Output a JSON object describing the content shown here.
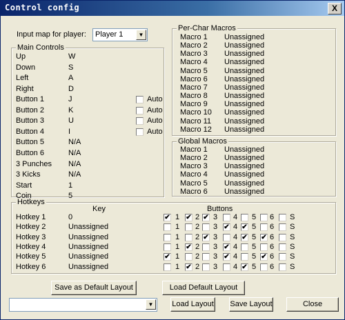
{
  "window": {
    "title": "Control config",
    "close_label": "X"
  },
  "player": {
    "label": "Input map for player:",
    "selected": "Player 1"
  },
  "main_controls": {
    "title": "Main Controls",
    "auto_label": "Auto",
    "rows": [
      {
        "name": "Up",
        "key": "W"
      },
      {
        "name": "Down",
        "key": "S"
      },
      {
        "name": "Left",
        "key": "A"
      },
      {
        "name": "Right",
        "key": "D"
      },
      {
        "name": "Button 1",
        "key": "J"
      },
      {
        "name": "Button 2",
        "key": "K"
      },
      {
        "name": "Button 3",
        "key": "U"
      },
      {
        "name": "Button 4",
        "key": "I"
      },
      {
        "name": "Button 5",
        "key": "N/A"
      },
      {
        "name": "Button 6",
        "key": "N/A"
      },
      {
        "name": "3 Punches",
        "key": "N/A"
      },
      {
        "name": "3 Kicks",
        "key": "N/A"
      },
      {
        "name": "Start",
        "key": "1"
      },
      {
        "name": "Coin",
        "key": "5"
      }
    ],
    "auto_checked": [
      false,
      false,
      false,
      false
    ]
  },
  "per_char_macros": {
    "title": "Per-Char Macros",
    "rows": [
      {
        "name": "Macro 1",
        "value": "Unassigned"
      },
      {
        "name": "Macro 2",
        "value": "Unassigned"
      },
      {
        "name": "Macro 3",
        "value": "Unassigned"
      },
      {
        "name": "Macro 4",
        "value": "Unassigned"
      },
      {
        "name": "Macro 5",
        "value": "Unassigned"
      },
      {
        "name": "Macro 6",
        "value": "Unassigned"
      },
      {
        "name": "Macro 7",
        "value": "Unassigned"
      },
      {
        "name": "Macro 8",
        "value": "Unassigned"
      },
      {
        "name": "Macro 9",
        "value": "Unassigned"
      },
      {
        "name": "Macro 10",
        "value": "Unassigned"
      },
      {
        "name": "Macro 11",
        "value": "Unassigned"
      },
      {
        "name": "Macro 12",
        "value": "Unassigned"
      }
    ]
  },
  "global_macros": {
    "title": "Global Macros",
    "rows": [
      {
        "name": "Macro 1",
        "value": "Unassigned"
      },
      {
        "name": "Macro 2",
        "value": "Unassigned"
      },
      {
        "name": "Macro 3",
        "value": "Unassigned"
      },
      {
        "name": "Macro 4",
        "value": "Unassigned"
      },
      {
        "name": "Macro 5",
        "value": "Unassigned"
      },
      {
        "name": "Macro 6",
        "value": "Unassigned"
      }
    ]
  },
  "hotkeys": {
    "title": "Hotkeys",
    "key_header": "Key",
    "buttons_header": "Buttons",
    "button_labels": [
      "1",
      "2",
      "3",
      "4",
      "5",
      "6",
      "S"
    ],
    "rows": [
      {
        "name": "Hotkey 1",
        "key": "0",
        "checked": [
          true,
          true,
          true,
          false,
          false,
          false,
          false
        ]
      },
      {
        "name": "Hotkey 2",
        "key": "Unassigned",
        "checked": [
          false,
          false,
          false,
          true,
          true,
          false,
          false
        ]
      },
      {
        "name": "Hotkey 3",
        "key": "Unassigned",
        "checked": [
          false,
          false,
          true,
          false,
          true,
          true,
          false
        ]
      },
      {
        "name": "Hotkey 4",
        "key": "Unassigned",
        "checked": [
          false,
          true,
          false,
          true,
          false,
          false,
          false
        ]
      },
      {
        "name": "Hotkey 5",
        "key": "Unassigned",
        "checked": [
          true,
          false,
          false,
          true,
          false,
          true,
          false
        ]
      },
      {
        "name": "Hotkey 6",
        "key": "Unassigned",
        "checked": [
          false,
          true,
          false,
          false,
          true,
          false,
          false
        ]
      }
    ]
  },
  "buttons": {
    "save_default": "Save as  Default Layout",
    "load_default": "Load Default Layout",
    "load_layout": "Load Layout",
    "save_layout": "Save Layout",
    "close": "Close"
  },
  "layout_combo": {
    "value": ""
  }
}
